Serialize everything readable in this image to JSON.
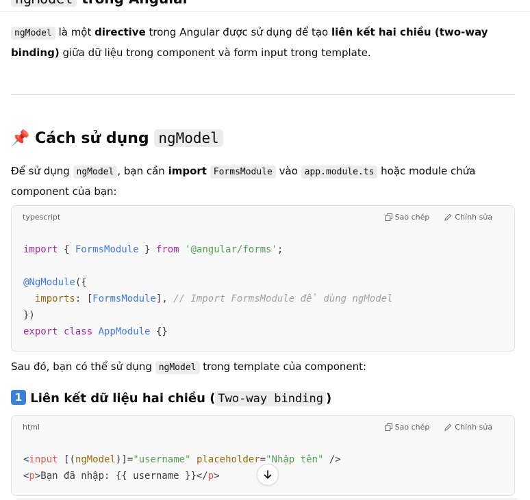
{
  "partial_heading": {
    "code": "ngModel",
    "text": " trong Angular"
  },
  "intro": {
    "code": "ngModel",
    "t1": " là một ",
    "b1": "directive",
    "t2": " trong Angular được sử dụng để tạo ",
    "b2": "liên kết hai chiều (two-way binding)",
    "t3": " giữa dữ liệu trong component và form input trong template."
  },
  "section_usage": {
    "emoji": "📌",
    "title": "Cách sử dụng ",
    "code": "ngModel"
  },
  "usage_paragraph": {
    "t1": "Để sử dụng ",
    "c1": "ngModel",
    "t2": ", bạn cần ",
    "b1": "import",
    "t3": " ",
    "c2": "FormsModule",
    "t4": " vào ",
    "c3": "app.module.ts",
    "t5": " hoặc module chứa component của bạn:"
  },
  "code_block_1": {
    "language": "typescript",
    "copy_label": "Sao chép",
    "edit_label": "Chỉnh sửa",
    "lines": {
      "l1_kw": "import",
      "l1_p1": " { ",
      "l1_ty": "FormsModule",
      "l1_p2": " } ",
      "l1_kw2": "from",
      "l1_p3": " ",
      "l1_st": "'@angular/forms'",
      "l1_p4": ";",
      "l3_dec": "@NgModule",
      "l3_p": "({",
      "l4_attr": "imports",
      "l4_p1": ": [",
      "l4_ty": "FormsModule",
      "l4_p2": "], ",
      "l4_cm": "// Import FormsModule để dùng ngModel",
      "l5": "})",
      "l6_kw1": "export",
      "l6_kw2": "class",
      "l6_ty": "AppModule",
      "l6_p": " {}"
    }
  },
  "after_code": {
    "t1": "Sau đó, bạn có thể sử dụng ",
    "c1": "ngModel",
    "t2": " trong template của component:"
  },
  "section_binding": {
    "number": "1",
    "title": "Liên kết dữ liệu hai chiều (",
    "code": "Two-way binding",
    "close": ")"
  },
  "code_block_2": {
    "language": "html",
    "copy_label": "Sao chép",
    "edit_label": "Chỉnh sửa",
    "lines": {
      "l1_lt": "<",
      "l1_tag": "input",
      "l1_p1": " [(",
      "l1_ngmodel": "ngModel",
      "l1_p2": ")]=",
      "l1_val": "\"username\"",
      "l1_sp": " ",
      "l1_attr": "placeholder",
      "l1_eq": "=",
      "l1_val2": "\"Nhập tên\"",
      "l1_end": " />",
      "l2_lt": "<",
      "l2_tag": "p",
      "l2_text": ">Bạn đã nhập: {{ username }}</",
      "l2_tag2": "p",
      "l2_gt": ">"
    }
  },
  "icons": {
    "copy": "copy-icon",
    "edit": "edit-icon",
    "scroll_down": "arrow-down-icon"
  }
}
